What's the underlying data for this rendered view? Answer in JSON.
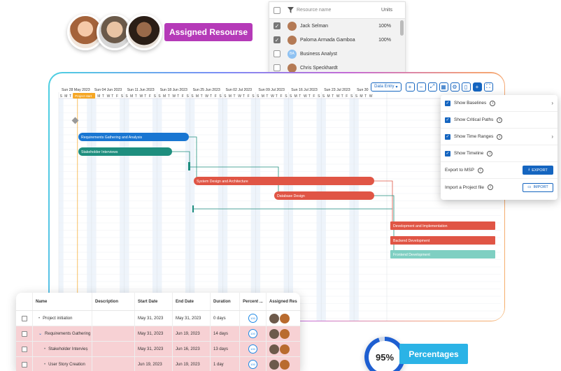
{
  "assigned_badge": "Assigned Resourse",
  "percent_badge": "Percentages",
  "percent_value": "95%",
  "percent_fraction": 0.95,
  "resource_popup": {
    "header_name": "Resource name",
    "header_units": "Units",
    "rows": [
      {
        "name": "Jack Selman",
        "units": "100%",
        "checked": true,
        "initials": ""
      },
      {
        "name": "Paloma Armada Gamboa",
        "units": "100%",
        "checked": true,
        "initials": ""
      },
      {
        "name": "Business Analyst",
        "units": "",
        "checked": false,
        "initials": "BA"
      },
      {
        "name": "Chris Speckhardt",
        "units": "",
        "checked": false,
        "initials": ""
      }
    ]
  },
  "toolbar": {
    "data_entry": "Data Entry",
    "icons": [
      "zoom-in-icon",
      "zoom-out-icon",
      "fit-icon",
      "calendar-icon",
      "settings-icon",
      "trash-icon",
      "add-icon",
      "fullscreen-icon"
    ]
  },
  "timeline": {
    "weeks": [
      "Sun 28 May 2023",
      "Sun 04 Jun 2023",
      "Sun 11 Jun 2023",
      "Sun 18 Jun 2023",
      "Sun 25 Jun 2023",
      "Sun 02 Jul 2023",
      "Sun 09 Jul 2023",
      "Sun 16 Jul 2023",
      "Sun 23 Jul 2023",
      "Sun 30"
    ],
    "days": "SMTWTFS",
    "project_start": "Project start"
  },
  "gantt_tasks": [
    {
      "label": "Requirements Gathering and Analysis",
      "color": "#1976d2",
      "type": "summary"
    },
    {
      "label": "Stakeholder Interviews",
      "color": "#1e8e7e",
      "type": "summary"
    },
    {
      "label": "System Design and Architecture",
      "color": "#e05545",
      "type": "summary"
    },
    {
      "label": "Database Design",
      "color": "#e05545",
      "type": "summary"
    },
    {
      "label": "Development and Implementation",
      "color": "#e05545",
      "type": "task"
    },
    {
      "label": "Backend Development",
      "color": "#e05545",
      "type": "task"
    },
    {
      "label": "Frontend Development",
      "color": "#7fcfc2",
      "type": "task"
    }
  ],
  "settings_panel": {
    "show_baselines": "Show Baselines",
    "show_critical": "Show Critical Paths",
    "show_time_ranges": "Show Time Ranges",
    "show_timeline": "Show Timeline",
    "export_to_msp": "Export to MSP",
    "export_btn": "EXPORT",
    "import_project": "Import a Project file",
    "import_btn": "IMPORT"
  },
  "grid": {
    "headers": [
      "Name",
      "Description",
      "Start Date",
      "End Date",
      "Duration",
      "Percent ...",
      "Assigned Res"
    ],
    "rows": [
      {
        "name": "Project initiation",
        "start": "May 31, 2023",
        "end": "May 31, 2023",
        "duration": "0 days",
        "pct": "100",
        "highlight": false
      },
      {
        "name": "Requirements Gathering",
        "start": "May 31, 2023",
        "end": "Jun 19, 2023",
        "duration": "14 days",
        "pct": "100",
        "highlight": true
      },
      {
        "name": "Stakeholder Intervieș",
        "start": "May 31, 2023",
        "end": "Jun 16, 2023",
        "duration": "13 days",
        "pct": "100",
        "highlight": true
      },
      {
        "name": "User Story Creation",
        "start": "Jun 19, 2023",
        "end": "Jun 19, 2023",
        "duration": "1 day",
        "pct": "100",
        "highlight": true
      }
    ]
  }
}
